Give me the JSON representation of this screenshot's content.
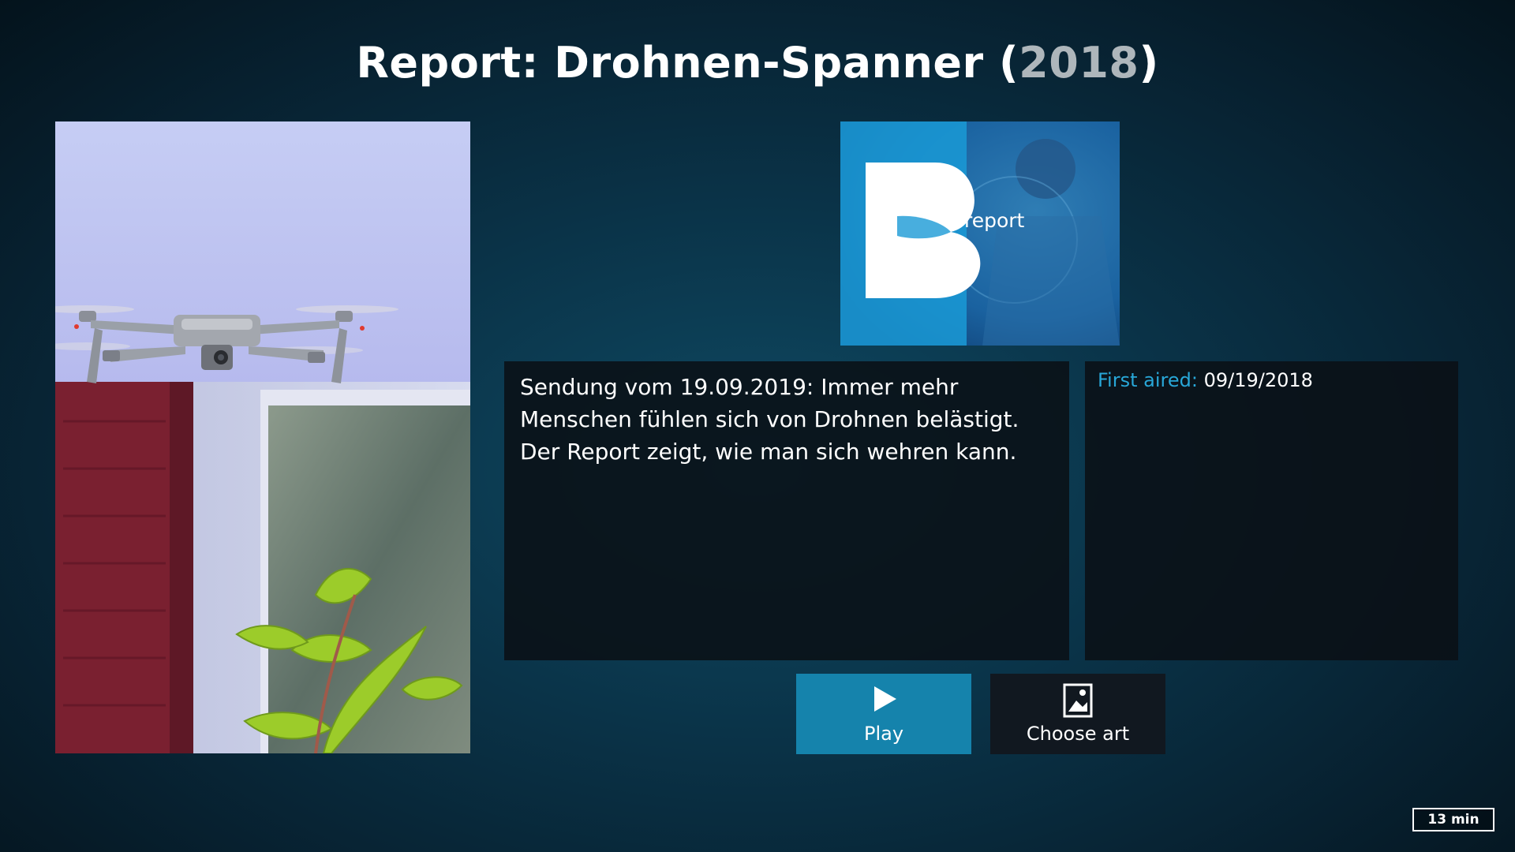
{
  "header": {
    "title": "Report: Drohnen-Spanner",
    "year_open": " (",
    "year": "2018",
    "year_close": ")"
  },
  "poster": {
    "icon": "drone-photo"
  },
  "banner": {
    "logo_letter": "B",
    "logo_text": "report"
  },
  "plot": {
    "text": "Sendung vom 19.09.2019: Immer mehr Menschen fühlen sich von Drohnen belästigt. Der Report zeigt, wie man sich wehren kann."
  },
  "info": {
    "first_aired_label": "First aired:",
    "first_aired_value": "09/19/2018"
  },
  "buttons": {
    "play_label": "Play",
    "choose_art_label": "Choose art"
  },
  "status": {
    "duration": "13 min"
  },
  "colors": {
    "accent": "#28a7d8",
    "play_button": "#1583ac",
    "panel_bg": "#0a1016"
  }
}
